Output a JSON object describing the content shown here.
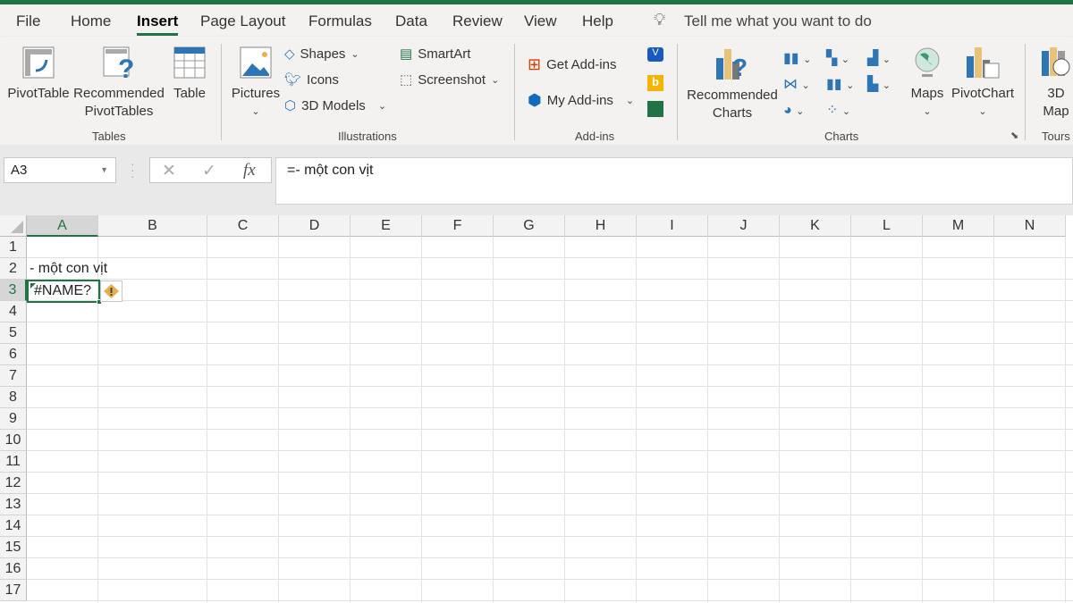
{
  "tabs": [
    "File",
    "Home",
    "Insert",
    "Page Layout",
    "Formulas",
    "Data",
    "Review",
    "View",
    "Help"
  ],
  "active_tab": "Insert",
  "tell_me": "Tell me what you want to do",
  "ribbon": {
    "tables": {
      "label": "Tables",
      "pivottable": "PivotTable",
      "recommended1": "Recommended",
      "recommended2": "PivotTables",
      "table": "Table"
    },
    "illustrations": {
      "label": "Illustrations",
      "pictures": "Pictures",
      "shapes": "Shapes",
      "icons": "Icons",
      "models": "3D Models",
      "smartart": "SmartArt",
      "screenshot": "Screenshot"
    },
    "addins": {
      "label": "Add-ins",
      "get": "Get Add-ins",
      "my": "My Add-ins"
    },
    "charts": {
      "label": "Charts",
      "recommended1": "Recommended",
      "recommended2": "Charts",
      "maps": "Maps",
      "pivotchart": "PivotChart"
    },
    "tours": {
      "label": "Tours",
      "map1": "3D",
      "map2": "Map"
    }
  },
  "name_box": "A3",
  "formula": "=- một con vịt",
  "columns": [
    "A",
    "B",
    "C",
    "D",
    "E",
    "F",
    "G",
    "H",
    "I",
    "J",
    "K",
    "L",
    "M",
    "N"
  ],
  "rows": [
    "1",
    "2",
    "3",
    "4",
    "5",
    "6",
    "7",
    "8",
    "9",
    "10",
    "11",
    "12",
    "13",
    "14",
    "15",
    "16",
    "17"
  ],
  "cells": {
    "A2": "- một con vịt",
    "A3": "#NAME?"
  },
  "colors": {
    "accent": "#217346",
    "warning": "#e8b04b"
  }
}
